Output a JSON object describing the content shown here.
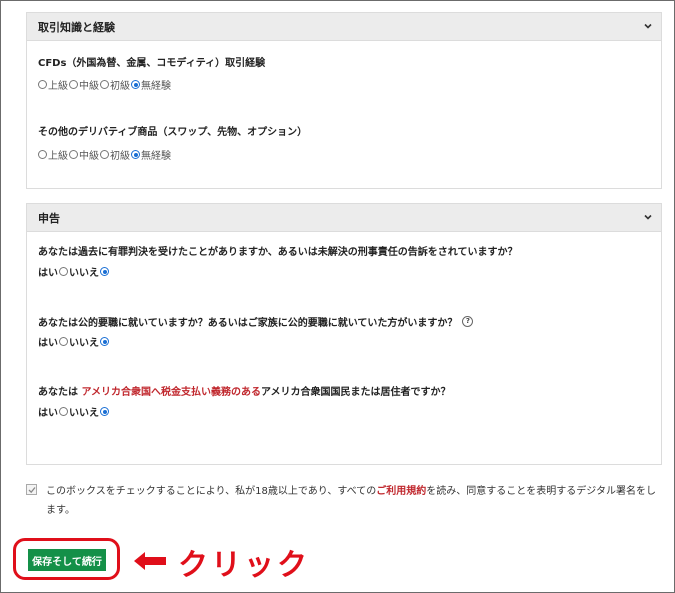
{
  "panels": {
    "experience": {
      "title": "取引知識と経験",
      "q1": {
        "label": "CFDs（外国為替、金属、コモディティ）取引経験"
      },
      "q2": {
        "label": "その他のデリバティブ商品（スワップ、先物、オプション）"
      },
      "options": [
        "上級",
        "中級",
        "初級",
        "無経験"
      ],
      "selected": "無経験"
    },
    "declaration": {
      "title": "申告",
      "q1": {
        "label": "あなたは過去に有罪判決を受けたことがありますか、あるいは未解決の刑事責任の告訴をされていますか？"
      },
      "q2": {
        "label": "あなたは公的要職に就いていますか？あるいはご家族に公的要職に就いていた方がいますか？"
      },
      "q3": {
        "prefix": "あなたは ",
        "highlight": "アメリカ合衆国へ税金支払い義務のある",
        "suffix": "アメリカ合衆国国民または居住者ですか？"
      },
      "yes": "はい",
      "no": "いいえ",
      "selected": "いいえ"
    }
  },
  "consent": {
    "text_before": "このボックスをチェックすることにより、私が18歳以上であり、すべての",
    "link": "ご利用規約",
    "text_after": "を読み、同意することを表明するデジタル署名をします。",
    "checked": true
  },
  "submit_button": {
    "label": "保存そして続行"
  },
  "annotation": {
    "label": "クリック",
    "color": "#e00f1a"
  },
  "colors": {
    "accent": "#149048",
    "radio": "#1a6fd4",
    "link": "#c0272d"
  }
}
